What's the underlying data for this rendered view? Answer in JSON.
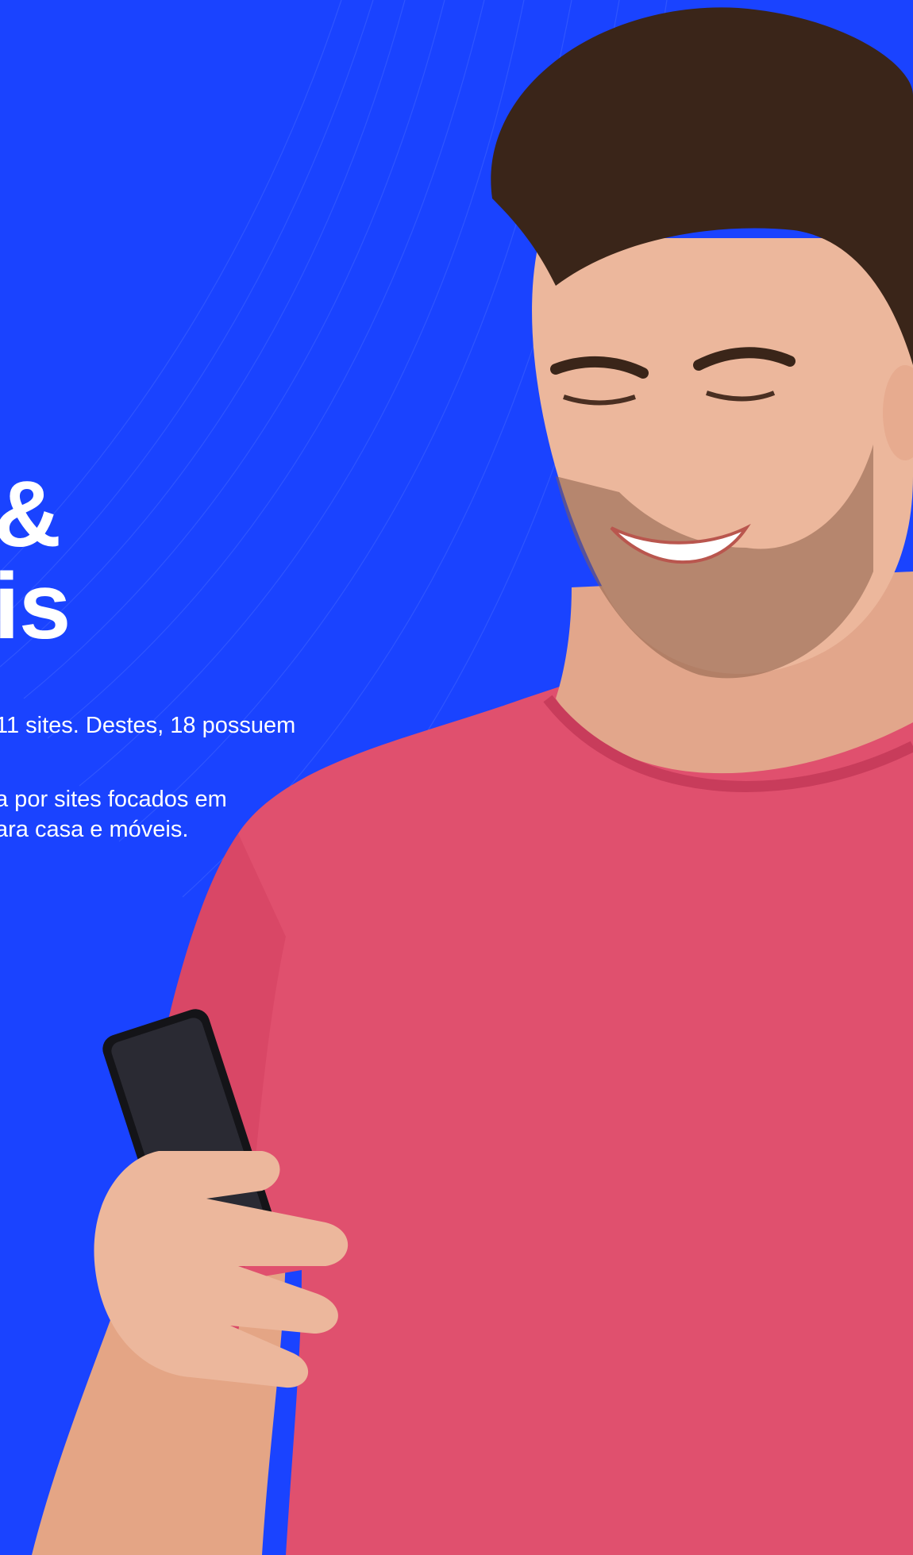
{
  "hero": {
    "heading_lines": [
      "&",
      "is"
    ],
    "paragraph_1": "11 sites. Destes, 18 possuem",
    "paragraph_2_lines": [
      "a por sites focados em",
      "ara casa e móveis."
    ]
  },
  "colors": {
    "background": "#1a43ff",
    "text": "#ffffff",
    "shirt": "#e0506e",
    "skin": "#e9b196",
    "hair": "#3a2519",
    "phone": "#141418"
  },
  "image": {
    "subject": "smiling-man-in-pink-tshirt-holding-smartphone"
  }
}
